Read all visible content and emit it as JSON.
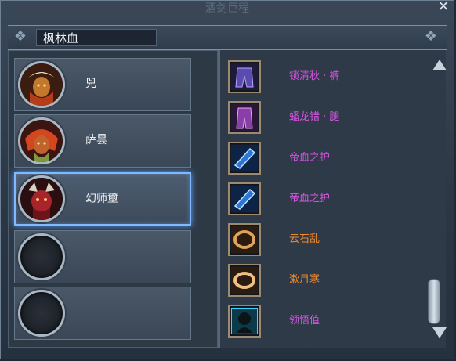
{
  "window": {
    "ghost_title": "酒剑巨程",
    "close_icon": "close-icon"
  },
  "header": {
    "title": "枫林血"
  },
  "characters": [
    {
      "name": "兕",
      "portrait": "character-portrait-icon"
    },
    {
      "name": "萨昙",
      "portrait": "character-portrait-icon"
    },
    {
      "name": "幻师壐",
      "portrait": "character-portrait-icon",
      "selected": true
    },
    {
      "name": "",
      "portrait": "empty-slot-icon"
    },
    {
      "name": "",
      "portrait": "empty-slot-icon"
    }
  ],
  "items": [
    {
      "name": "锁清秋 · 裤",
      "color": "#d455e0",
      "icon": "armor-pants-icon"
    },
    {
      "name": "蟠龙错 · 腿",
      "color": "#d455e0",
      "icon": "armor-legs-icon"
    },
    {
      "name": "帝血之护",
      "color": "#d455e0",
      "icon": "bracer-icon"
    },
    {
      "name": "帝血之护",
      "color": "#d455e0",
      "icon": "bracer-icon"
    },
    {
      "name": "云石乱",
      "color": "#f08a2c",
      "icon": "ring-icon"
    },
    {
      "name": "漱月寒",
      "color": "#f08a2c",
      "icon": "ring-icon"
    },
    {
      "name": "领悟值",
      "color": "#d455e0",
      "icon": "insight-head-icon"
    }
  ],
  "colors": {
    "selected_border": "#7fb9ff",
    "purple_item": "#d455e0",
    "orange_item": "#f08a2c"
  }
}
